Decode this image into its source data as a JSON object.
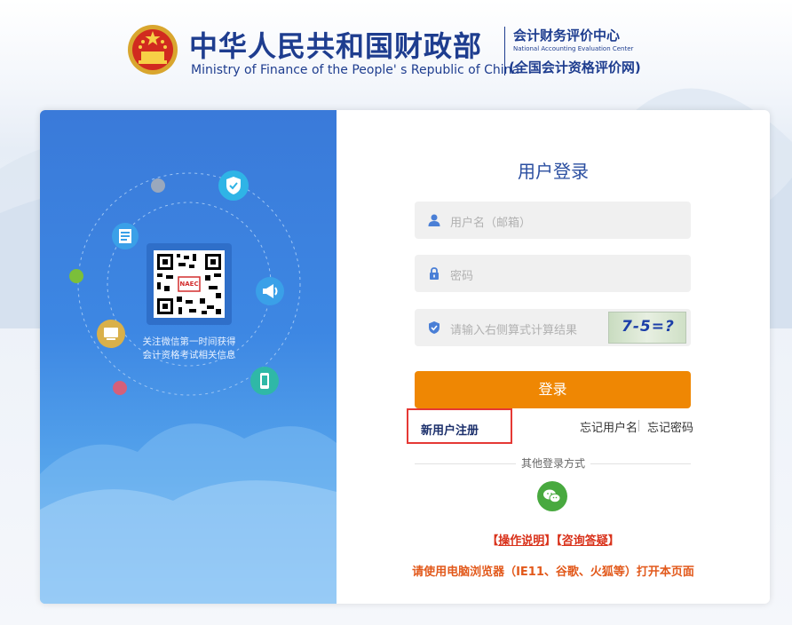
{
  "header": {
    "title_cn": "中华人民共和国财政部",
    "title_en": "Ministry of Finance of the People' s Republic of China",
    "center_cn": "会计财务评价中心",
    "center_en": "National Accounting Evaluation Center",
    "center_sub": "(全国会计资格评价网)"
  },
  "promo": {
    "qr_badge": "NAEC",
    "caption_line1": "关注微信第一时间获得",
    "caption_line2": "会计资格考试相关信息"
  },
  "login": {
    "title": "用户登录",
    "username_placeholder": "用户名（邮箱）",
    "password_placeholder": "密码",
    "captcha_placeholder": "请输入右侧算式计算结果",
    "captcha_text": "7-5=?",
    "login_button": "登录",
    "register_link": "新用户注册",
    "forgot_username": "忘记用户名",
    "forgot_password": "忘记密码",
    "other_methods": "其他登录方式"
  },
  "links": {
    "instructions_open": "【",
    "instructions": "操作说明",
    "instructions_close": "】",
    "faq_open": "【",
    "faq": "咨询答疑",
    "faq_close": "】"
  },
  "notice": "请使用电脑浏览器（IE11、谷歌、火狐等）打开本页面",
  "colors": {
    "brand_blue": "#1e3d8f",
    "login_button": "#ef8703",
    "register_highlight": "#e53935",
    "wechat_green": "#48a93f"
  },
  "icons": [
    "national-emblem-icon",
    "user-icon",
    "lock-icon",
    "shield-icon",
    "wechat-icon",
    "shield-check-icon",
    "document-icon",
    "megaphone-icon",
    "mobile-icon",
    "monitor-icon"
  ]
}
